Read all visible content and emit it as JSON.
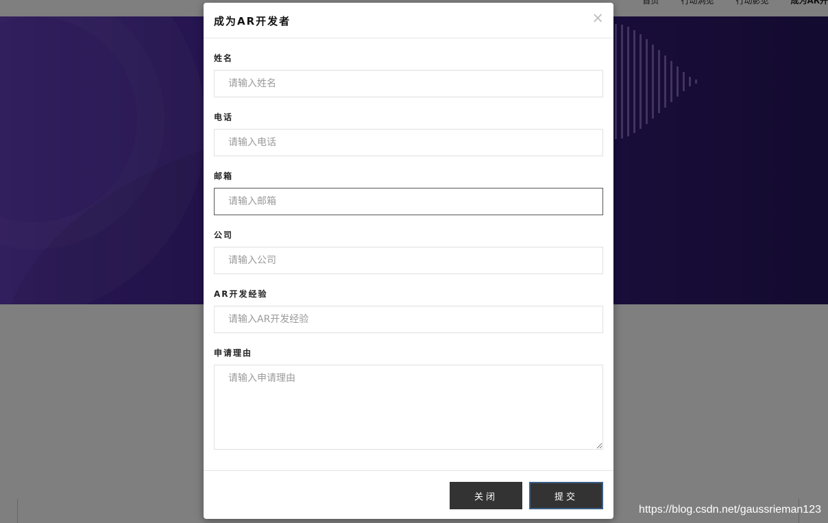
{
  "nav": {
    "links": [
      "首页",
      "行动洞见",
      "行动影见",
      "成为AR开"
    ]
  },
  "modal": {
    "title": "成为AR开发者",
    "close_symbol": "×",
    "fields": [
      {
        "label": "姓名",
        "placeholder": "请输入姓名"
      },
      {
        "label": "电话",
        "placeholder": "请输入电话"
      },
      {
        "label": "邮箱",
        "placeholder": "请输入邮箱"
      },
      {
        "label": "公司",
        "placeholder": "请输入公司"
      },
      {
        "label": "AR开发经验",
        "placeholder": "请输入AR开发经验"
      },
      {
        "label": "申请理由",
        "placeholder": "请输入申请理由"
      }
    ],
    "buttons": {
      "close": "关闭",
      "submit": "提交"
    }
  },
  "watermark": "https://blog.csdn.net/gaussrieman123",
  "colors": {
    "hero": "#3f2090",
    "button": "#333333",
    "submit_border": "#3a5f86",
    "overlay": "rgba(0,0,0,0.5)"
  }
}
